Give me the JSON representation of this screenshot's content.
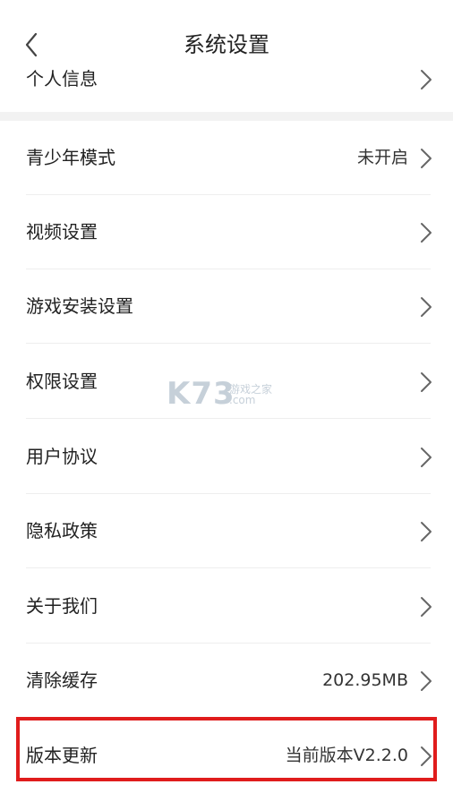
{
  "header": {
    "title": "系统设置"
  },
  "personal": {
    "label": "个人信息"
  },
  "items": [
    {
      "label": "青少年模式",
      "value": "未开启"
    },
    {
      "label": "视频设置",
      "value": ""
    },
    {
      "label": "游戏安装设置",
      "value": ""
    },
    {
      "label": "权限设置",
      "value": ""
    },
    {
      "label": "用户协议",
      "value": ""
    },
    {
      "label": "隐私政策",
      "value": ""
    },
    {
      "label": "关于我们",
      "value": ""
    },
    {
      "label": "清除缓存",
      "value": "202.95MB"
    },
    {
      "label": "版本更新",
      "value": "当前版本V2.2.0"
    }
  ],
  "watermark": {
    "brand": "K73",
    "line1": "游戏之家",
    "line2": ".com"
  },
  "colors": {
    "highlight": "#e01c1c",
    "section_gap": "#f2f2f2",
    "divider": "#eeeeee"
  },
  "icons": {
    "back": "chevron-left-icon",
    "row": "chevron-right-icon"
  }
}
